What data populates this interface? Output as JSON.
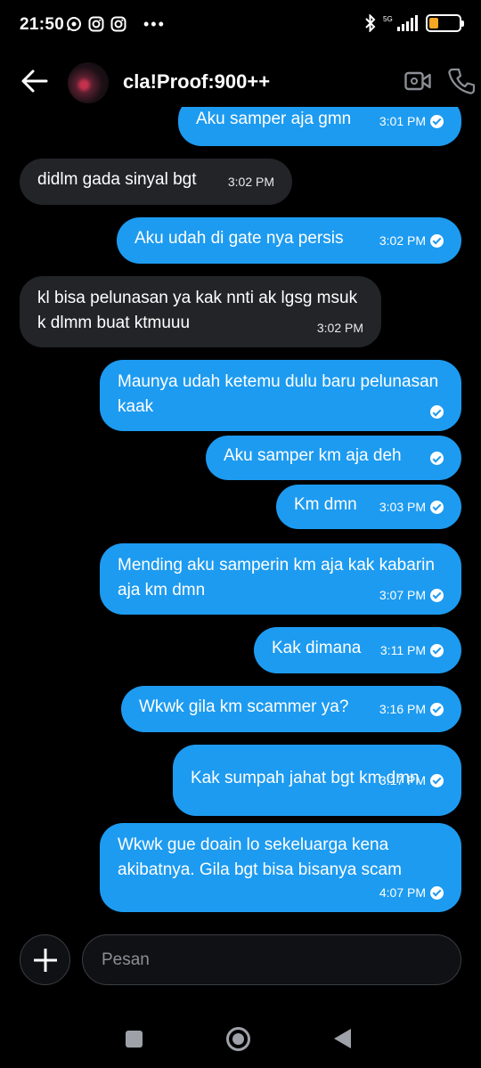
{
  "status_bar": {
    "time": "21:50",
    "network": "5G",
    "battery": "31",
    "battery_level": 0.31
  },
  "header": {
    "title": "cla!Proof:900++"
  },
  "messages": [
    {
      "dir": "out",
      "text": "Aku samper aja gmn",
      "time": "3:01 PM",
      "read": true
    },
    {
      "dir": "in",
      "text": "didlm gada sinyal bgt",
      "time": "3:02 PM"
    },
    {
      "dir": "out",
      "text": "Aku udah di gate nya persis",
      "time": "3:02 PM",
      "read": true
    },
    {
      "dir": "in",
      "text": "kl bisa pelunasan ya kak nnti ak lgsg msuk k dlmm buat ktmuuu",
      "time": "3:02 PM"
    },
    {
      "dir": "out",
      "text": "Maunya udah ketemu dulu baru pelunasan kaak",
      "time": "",
      "read": true
    },
    {
      "dir": "out",
      "text": "Aku samper km aja deh",
      "time": "",
      "read": true
    },
    {
      "dir": "out",
      "text": "Km dmn",
      "time": "3:03 PM",
      "read": true
    },
    {
      "dir": "out",
      "text": "Mending aku samperin km aja kak kabarin aja km dmn",
      "time": "3:07 PM",
      "read": true
    },
    {
      "dir": "out",
      "text": "Kak dimana",
      "time": "3:11 PM",
      "read": true
    },
    {
      "dir": "out",
      "text": "Wkwk gila km scammer ya?",
      "time": "3:16 PM",
      "read": true
    },
    {
      "dir": "out",
      "text": "Kak sumpah jahat bgt km dmn",
      "time": "3:17 PM",
      "read": true
    },
    {
      "dir": "out",
      "text": "Wkwk gue doain lo sekeluarga kena akibatnya. Gila bgt bisa bisanya scam",
      "time": "4:07 PM",
      "read": true
    }
  ],
  "composer": {
    "placeholder": "Pesan"
  },
  "colors": {
    "outgoing": "#1d9bf0",
    "incoming": "#232428",
    "background": "#000000"
  },
  "icons": [
    "back-arrow-icon",
    "video-call-icon",
    "phone-call-icon",
    "plus-icon",
    "whatsapp-icon",
    "instagram-icon",
    "bluetooth-icon",
    "signal-icon",
    "battery-icon"
  ]
}
